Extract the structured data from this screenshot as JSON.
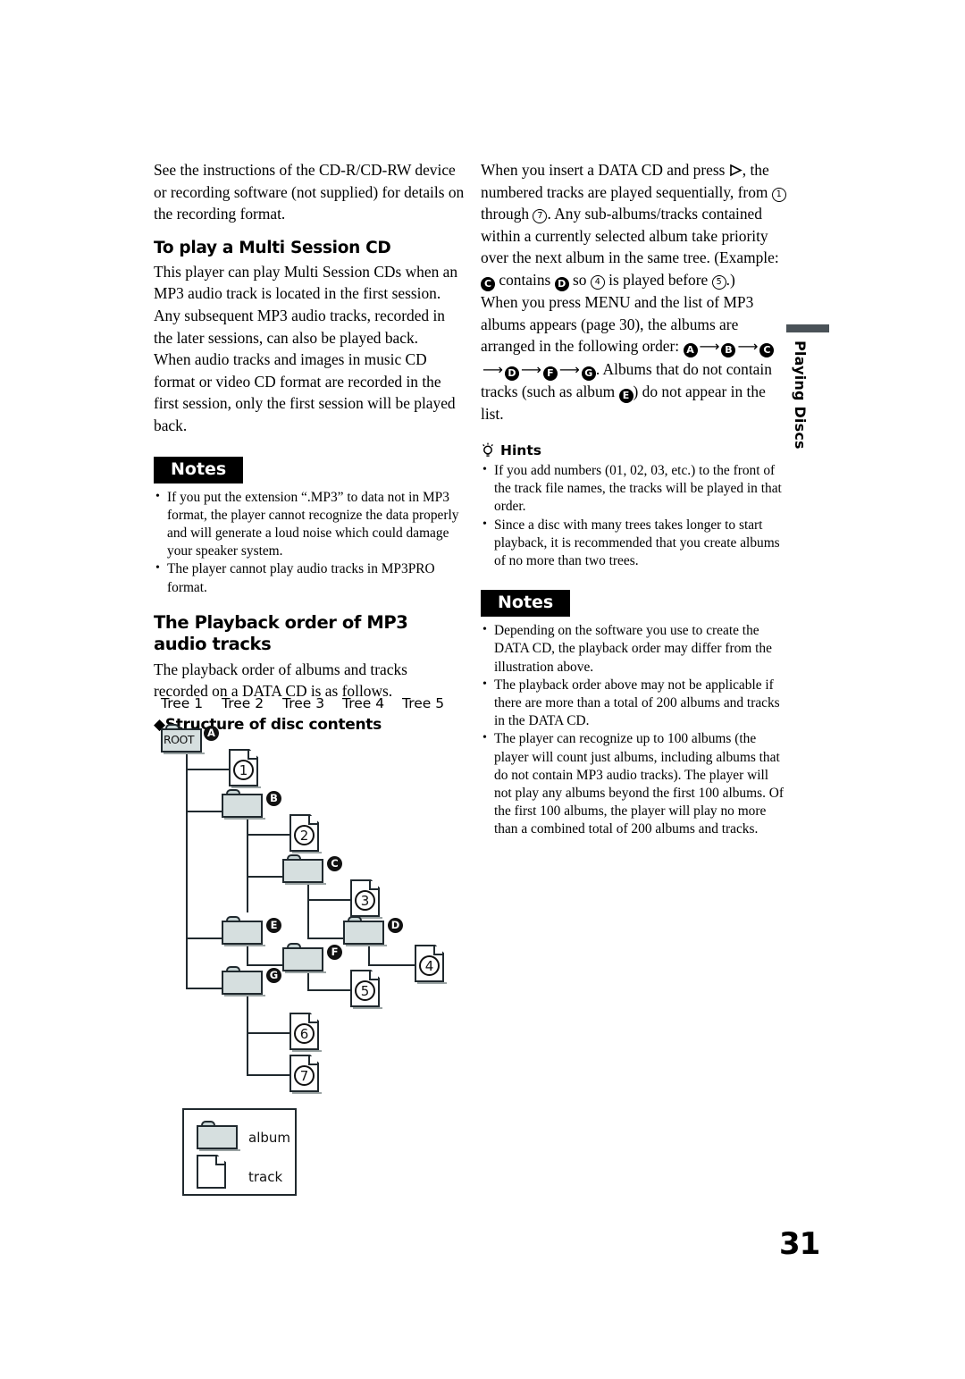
{
  "page": {
    "number": "31",
    "side_tab": "Playing Discs"
  },
  "left_column": {
    "intro_paragraph": "See the instructions of the CD-R/CD-RW device or recording software (not supplied) for details on the recording format.",
    "heading_multi_session": "To play a Multi Session CD",
    "multi_session_paragraph_1": "This player can play Multi Session CDs when an MP3 audio track is located in the first session. Any subsequent MP3 audio tracks, recorded in the later sessions, can also be played back.",
    "multi_session_paragraph_2": "When audio tracks and images in music CD format or video CD format are recorded in the first session, only the first session will be played back.",
    "notes_badge": "Notes",
    "notes": [
      "If you put the extension “.MP3” to data not in MP3 format, the player cannot recognize the data properly and will generate a loud noise which could damage your speaker system.",
      "The player cannot play audio tracks in MP3PRO format."
    ],
    "heading_playback_order": "The Playback order of MP3 audio tracks",
    "playback_order_paragraph": "The playback order of albums and tracks recorded on a DATA CD is as follows.",
    "heading_structure": "Structure of disc contents",
    "diamond_glyph": "◆"
  },
  "right_column": {
    "paragraph_1_part1": "When you insert a DATA CD and press ",
    "paragraph_1_part2": ", the numbered tracks are played sequentially, from ",
    "paragraph_1_num_from": "1",
    "paragraph_1_part3": " through ",
    "paragraph_1_num_to": "7",
    "paragraph_1_part4": ". Any sub-albums/tracks contained within a currently selected album take priority over the next album in the same tree. (Example: ",
    "paragraph_1_letter_c": "C",
    "paragraph_1_part5": " contains ",
    "paragraph_1_letter_d": "D",
    "paragraph_1_part6": " so ",
    "paragraph_1_num_4": "4",
    "paragraph_1_part7": " is played before ",
    "paragraph_1_num_5": "5",
    "paragraph_1_part8": ".)",
    "paragraph_2_part1": "When you press MENU and the list of MP3 albums appears (page 30), the albums are arranged in the following order: ",
    "order_letters": [
      "A",
      "B",
      "C",
      "D",
      "F",
      "G"
    ],
    "paragraph_2_part2": ". Albums that do not contain tracks (such as album ",
    "paragraph_2_letter_e": "E",
    "paragraph_2_part3": ") do not appear in the list.",
    "hints_heading": "Hints",
    "hints": [
      "If you add numbers (01, 02, 03, etc.) to the front of the track file names, the tracks will be played in that order.",
      "Since a disc with many trees takes longer to start playback, it is recommended that you create albums of no more than two trees."
    ],
    "notes_badge": "Notes",
    "notes": [
      "Depending on the software you use to create the DATA CD, the playback order may differ from the illustration above.",
      "The playback order above may not be applicable if there are more than a total of 200 albums and tracks in the DATA CD.",
      "The player can recognize up to 100 albums (the player will count just albums, including albums that do not contain MP3 audio tracks). The player will not play any albums beyond the first 100 albums. Of the first 100 albums, the player will play no more than a combined total of 200 albums and tracks."
    ]
  },
  "diagram": {
    "tree_labels": [
      "Tree 1",
      "Tree 2",
      "Tree 3",
      "Tree 4",
      "Tree 5"
    ],
    "root_label": "ROOT",
    "folders": [
      {
        "id": "root",
        "badge": "A",
        "label": "ROOT"
      },
      {
        "id": "b",
        "badge": "B",
        "label": ""
      },
      {
        "id": "c",
        "badge": "C",
        "label": ""
      },
      {
        "id": "e",
        "badge": "E",
        "label": ""
      },
      {
        "id": "d",
        "badge": "D",
        "label": ""
      },
      {
        "id": "f",
        "badge": "F",
        "label": ""
      },
      {
        "id": "g",
        "badge": "G",
        "label": ""
      }
    ],
    "files": [
      {
        "id": "t1",
        "num": "1"
      },
      {
        "id": "t2",
        "num": "2"
      },
      {
        "id": "t3",
        "num": "3"
      },
      {
        "id": "t4",
        "num": "4"
      },
      {
        "id": "t5",
        "num": "5"
      },
      {
        "id": "t6",
        "num": "6"
      },
      {
        "id": "t7",
        "num": "7"
      }
    ],
    "legend": {
      "album_label": "album",
      "track_label": "track"
    }
  },
  "colors": {
    "folder_fill": "#d6dfdf",
    "folder_tab_fill": "#c7d4d4",
    "outline": "#20292e",
    "side_tab_bar": "#4a5258",
    "badge_bg": "#000000"
  }
}
